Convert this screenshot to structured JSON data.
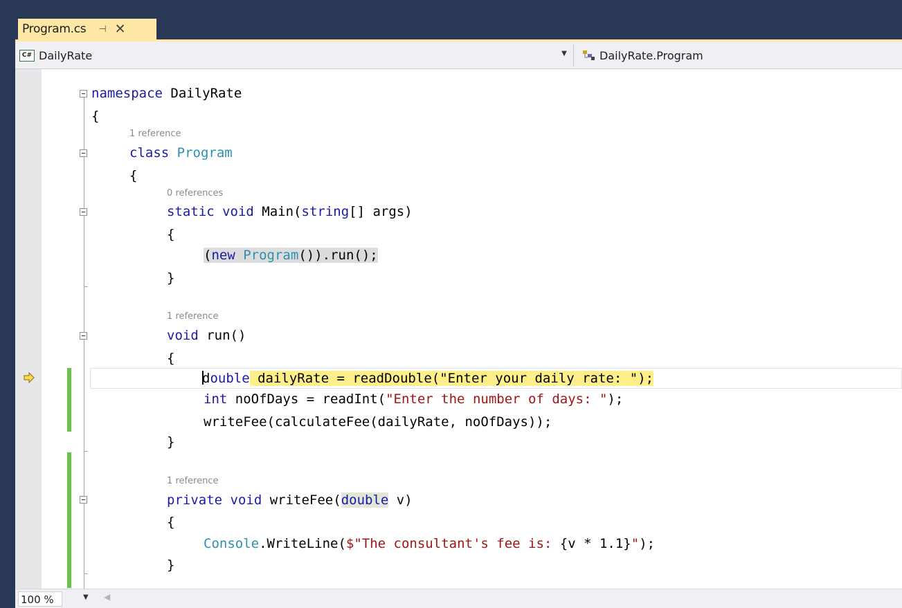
{
  "tab": {
    "title": "Program.cs",
    "pin_glyph": "⊣",
    "close_glyph": "✕"
  },
  "navbar": {
    "project": "DailyRate",
    "project_icon_text": "C#",
    "type": "DailyRate.Program"
  },
  "code": {
    "lens_1": "1 reference",
    "lens_2": "0 references",
    "lens_3": "1 reference",
    "lens_4": "1 reference",
    "line_namespace_kw": "namespace",
    "line_namespace_name": " DailyRate",
    "brace_open": "{",
    "brace_close": "}",
    "class_kw": "class",
    "class_name": "Program",
    "main_static": "static",
    "main_void": "void",
    "main_name": " Main(",
    "main_string": "string",
    "main_args": "[] args)",
    "call_open": "(",
    "call_new": "new",
    "call_program": "Program",
    "call_rest": "()).run();",
    "run_void": "void",
    "run_name": " run()",
    "line_daily_caret_d": "d",
    "line_daily_kw": "ouble",
    "line_daily_rest": " dailyRate = readDouble(",
    "line_daily_str": "\"Enter your daily rate: \"",
    "line_daily_end": ");",
    "line_int_kw": "int",
    "line_int_rest": " noOfDays = readInt(",
    "line_int_str": "\"Enter the number of days: \"",
    "line_int_end": ");",
    "line_write": "writeFee(calculateFee(dailyRate, noOfDays));",
    "wf_private": "private",
    "wf_void": "void",
    "wf_name": " writeFee(",
    "wf_double": "double",
    "wf_v": " v)",
    "cw_console": "Console",
    "cw_rest": ".WriteLine(",
    "cw_str1": "$\"The consultant's fee is: ",
    "cw_expr": "{v * 1.1}",
    "cw_str2": "\"",
    "cw_end": ");"
  },
  "statusbar": {
    "zoom": "100 %"
  },
  "colors": {
    "keyword": "#1a1aa6",
    "type": "#2b91af",
    "string": "#a31515",
    "tab_active": "#ffe8a6",
    "change_bar": "#6cc24a"
  }
}
